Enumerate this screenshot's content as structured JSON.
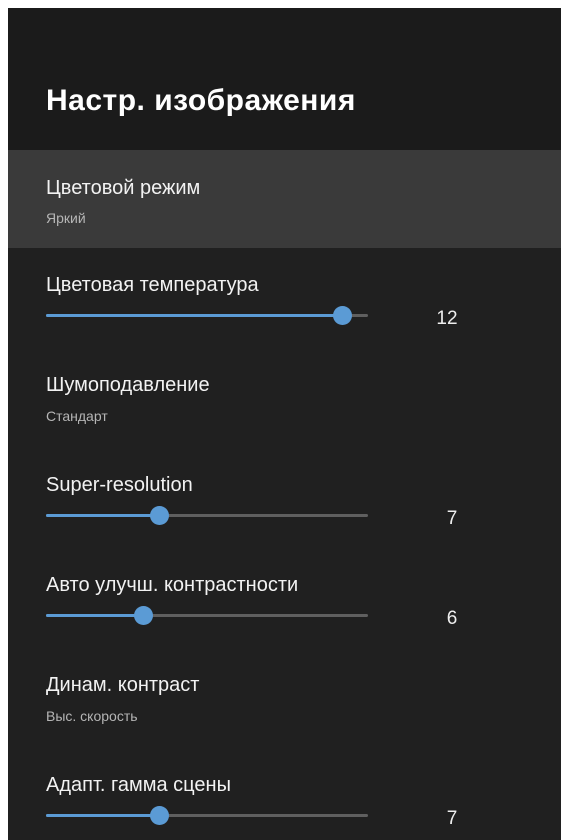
{
  "header": {
    "title": "Настр. изображения"
  },
  "colors": {
    "accent": "#5b9bd5",
    "track": "#5f5f5f",
    "focus_background": "#3a3a3a"
  },
  "settings": [
    {
      "label": "Цветовой режим",
      "value": "Яркий"
    },
    {
      "label": "Цветовая температура",
      "slider_value": "12",
      "slider_fraction": 0.92
    },
    {
      "label": "Шумоподавление",
      "value": "Стандарт"
    },
    {
      "label": "Super-resolution",
      "slider_value": "7",
      "slider_fraction": 0.35
    },
    {
      "label": "Авто улучш. контрастности",
      "slider_value": "6",
      "slider_fraction": 0.3
    },
    {
      "label": "Динам. контраст",
      "value": "Выс. скорость"
    },
    {
      "label": "Адапт. гамма сцены",
      "slider_value": "7",
      "slider_fraction": 0.35
    }
  ]
}
